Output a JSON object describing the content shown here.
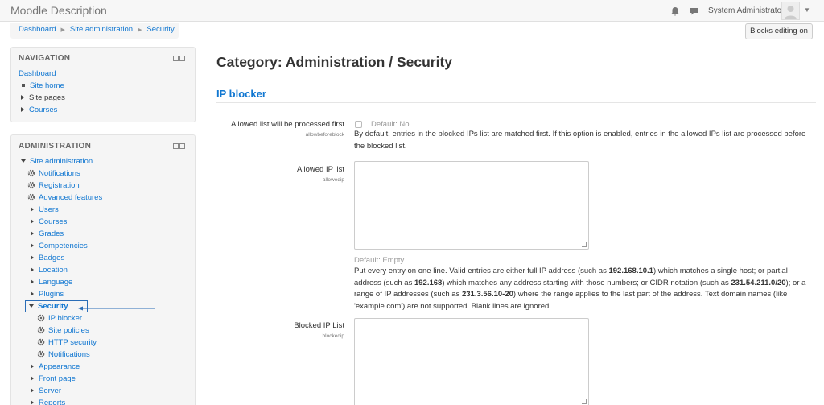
{
  "header": {
    "brand": "Moodle Description",
    "user_name": "System Administrator"
  },
  "breadcrumb": [
    "Dashboard",
    "Site administration",
    "Security"
  ],
  "blocks_editing_button": "Blocks editing on",
  "navigation": {
    "title": "NAVIGATION",
    "items": [
      "Dashboard",
      "Site home",
      "Site pages",
      "Courses"
    ]
  },
  "administration": {
    "title": "ADMINISTRATION",
    "items": [
      "Site administration",
      "Notifications",
      "Registration",
      "Advanced features",
      "Users",
      "Courses",
      "Grades",
      "Competencies",
      "Badges",
      "Location",
      "Language",
      "Plugins",
      "Security",
      "IP blocker",
      "Site policies",
      "HTTP security",
      "Notifications",
      "Appearance",
      "Front page",
      "Server",
      "Reports"
    ]
  },
  "main": {
    "heading": "Category: Administration / Security",
    "section": "IP blocker",
    "settings": [
      {
        "label": "Allowed list will be processed first",
        "key": "allowbeforeblock",
        "default": "Default: No",
        "description": "By default, entries in the blocked IPs list are matched first. If this option is enabled, entries in the allowed IPs list are processed before the blocked list."
      },
      {
        "label": "Allowed IP list",
        "key": "allowedip",
        "default": "Default: Empty",
        "description_parts": [
          "Put every entry on one line. Valid entries are either full IP address (such as ",
          "192.168.10.1",
          ") which matches a single host; or partial address (such as ",
          "192.168",
          ") which matches any address starting with those numbers; or CIDR notation (such as ",
          "231.54.211.0/20",
          "); or a range of IP addresses (such as ",
          "231.3.56.10-20",
          ") where the range applies to the last part of the address. Text domain names (like 'example.com') are not supported. Blank lines are ignored."
        ]
      },
      {
        "label": "Blocked IP List",
        "key": "blockedip"
      }
    ]
  },
  "colors": {
    "link": "#1177d1",
    "highlight": "#2a6db7"
  }
}
